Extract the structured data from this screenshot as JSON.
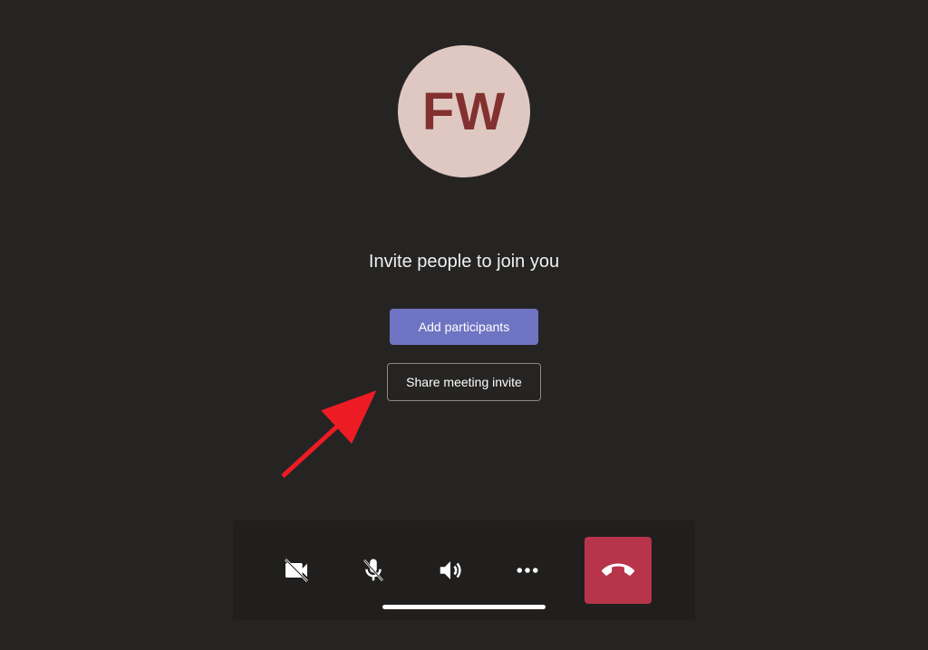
{
  "avatar": {
    "initials": "FW",
    "bg_color": "#e0c8c2",
    "text_color": "#823030"
  },
  "main": {
    "invite_heading": "Invite people to join you",
    "add_participants_label": "Add participants",
    "share_invite_label": "Share meeting invite"
  },
  "controls": {
    "camera": "camera-off-icon",
    "mic": "mic-off-icon",
    "speaker": "speaker-icon",
    "more": "more-options-icon",
    "hangup": "hangup-icon"
  },
  "colors": {
    "bg": "#252423",
    "toolbar_bg": "#201f1e",
    "primary_button": "#6f74c2",
    "hangup_button": "#b7344a",
    "annotation_arrow": "#ed1c24"
  }
}
